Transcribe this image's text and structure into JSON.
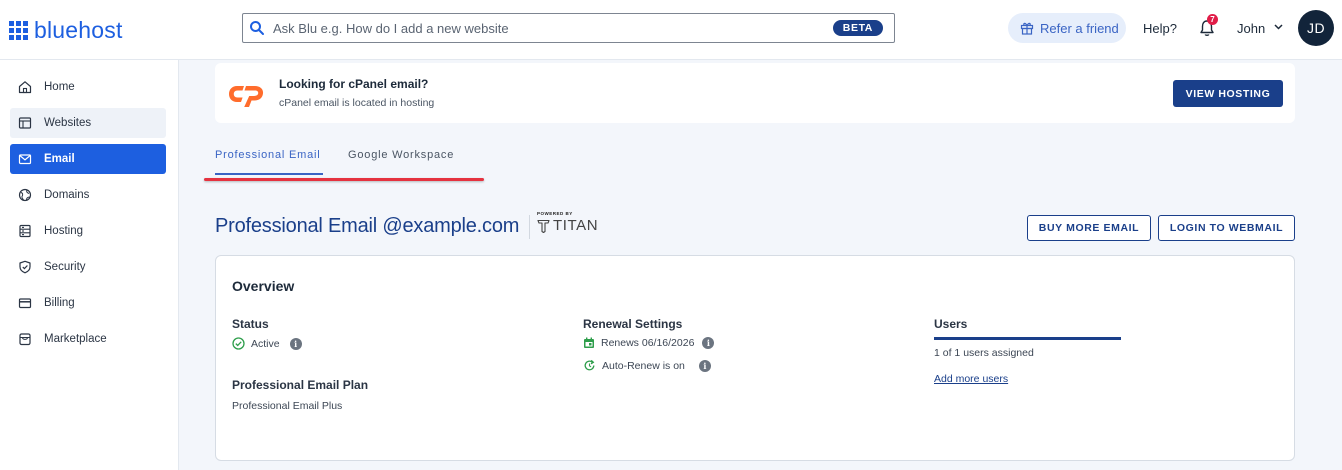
{
  "header": {
    "logo_text": "bluehost",
    "search_placeholder": "Ask Blu e.g. How do I add a new website",
    "search_badge": "BETA",
    "refer_label": "Refer a friend",
    "help_label": "Help?",
    "notification_count": "7",
    "user_name": "John",
    "avatar_initials": "JD"
  },
  "sidebar": {
    "items": [
      {
        "label": "Home",
        "icon": "home-icon"
      },
      {
        "label": "Websites",
        "icon": "browser-icon"
      },
      {
        "label": "Email",
        "icon": "envelope-icon"
      },
      {
        "label": "Domains",
        "icon": "globe-icon"
      },
      {
        "label": "Hosting",
        "icon": "server-icon"
      },
      {
        "label": "Security",
        "icon": "shield-icon"
      },
      {
        "label": "Billing",
        "icon": "credit-card-icon"
      },
      {
        "label": "Marketplace",
        "icon": "store-icon"
      }
    ],
    "active": "Email"
  },
  "banner": {
    "title": "Looking for cPanel email?",
    "subtitle": "cPanel email is located in hosting",
    "button": "VIEW HOSTING"
  },
  "tabs": [
    {
      "label": "Professional Email",
      "active": true
    },
    {
      "label": "Google Workspace",
      "active": false
    }
  ],
  "page": {
    "title": "Professional Email @example.com",
    "powered_by": "POWERED BY",
    "titan": "TITAN",
    "buy_button": "BUY MORE EMAIL",
    "login_button": "LOGIN TO WEBMAIL"
  },
  "overview": {
    "title": "Overview",
    "status_label": "Status",
    "status_value": "Active",
    "plan_label": "Professional Email Plan",
    "plan_value": "Professional Email Plus",
    "renewal_label": "Renewal Settings",
    "renews": "Renews 06/16/2026",
    "auto_renew": "Auto-Renew is on",
    "users_label": "Users",
    "users_assigned": "1 of 1 users assigned",
    "add_users": "Add more users"
  },
  "colors": {
    "brand": "#1d5fe0",
    "navy": "#1a3f8a",
    "success": "#2e9e4b",
    "cpanel": "#ff6c2c",
    "highlight": "#e5323f"
  }
}
